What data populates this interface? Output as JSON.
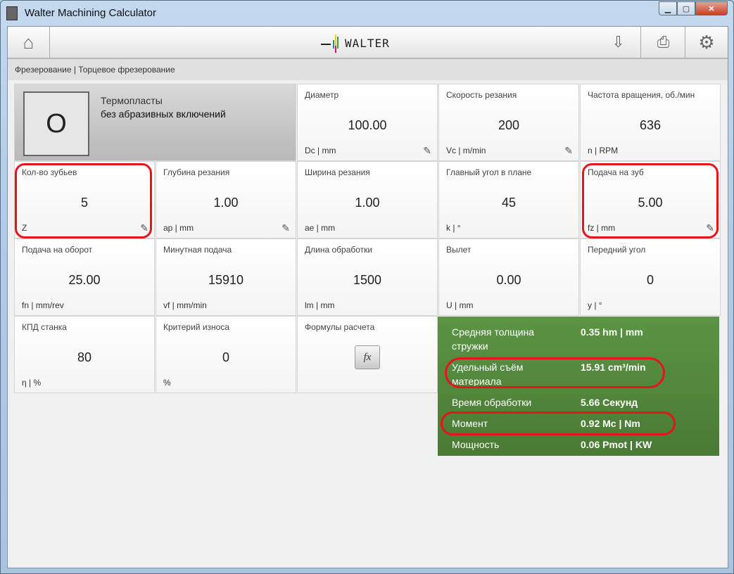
{
  "window": {
    "title": "Walter Machining Calculator"
  },
  "toolbar": {
    "logo": "WALTER"
  },
  "breadcrumb": "Фрезерование | Торцевое фрезерование",
  "material": {
    "code": "O",
    "name": "Термопласты",
    "description": "без абразивных включений"
  },
  "cells": [
    {
      "label": "Диаметр",
      "value": "100.00",
      "unit": "Dc | mm",
      "editable": true
    },
    {
      "label": "Скорость резания",
      "value": "200",
      "unit": "Vc | m/min",
      "editable": true
    },
    {
      "label": "Частота вращения, об./мин",
      "value": "636",
      "unit": "n | RPM",
      "editable": false
    },
    {
      "label": "Кол-во зубьев",
      "value": "5",
      "unit": "Z",
      "editable": true
    },
    {
      "label": "Глубина резания",
      "value": "1.00",
      "unit": "ap | mm",
      "editable": true
    },
    {
      "label": "Ширина резания",
      "value": "1.00",
      "unit": "ae | mm",
      "editable": false
    },
    {
      "label": "Главный угол в плане",
      "value": "45",
      "unit": "k | °",
      "editable": false
    },
    {
      "label": "Подача на зуб",
      "value": "5.00",
      "unit": "fz | mm",
      "editable": true
    },
    {
      "label": "Подача на оборот",
      "value": "25.00",
      "unit": "fn | mm/rev",
      "editable": false
    },
    {
      "label": "Минутная подача",
      "value": "15910",
      "unit": "vf | mm/min",
      "editable": false
    },
    {
      "label": "Длина обработки",
      "value": "1500",
      "unit": "lm | mm",
      "editable": false
    },
    {
      "label": "Вылет",
      "value": "0.00",
      "unit": "U | mm",
      "editable": false
    },
    {
      "label": "Передний угол",
      "value": "0",
      "unit": "y | °",
      "editable": false
    },
    {
      "label": "КПД станка",
      "value": "80",
      "unit": "η | %",
      "editable": false
    },
    {
      "label": "Критерий износа",
      "value": "0",
      "unit": "%",
      "editable": false
    }
  ],
  "formulas": {
    "label": "Формулы расчета",
    "button": "fx"
  },
  "results": [
    {
      "label": "Средняя толщина стружки",
      "value": "0.35 hm | mm"
    },
    {
      "label": "Удельный съём материала",
      "value": "15.91 cm³/min"
    },
    {
      "label": "Время обработки",
      "value": "5.66 Секунд"
    },
    {
      "label": "Момент",
      "value": "0.92 Mc | Nm"
    },
    {
      "label": "Мощность",
      "value": "0.06 Pmot | KW"
    }
  ],
  "colors": {
    "results_bg": "#548a3c",
    "highlight": "#e8141c"
  }
}
